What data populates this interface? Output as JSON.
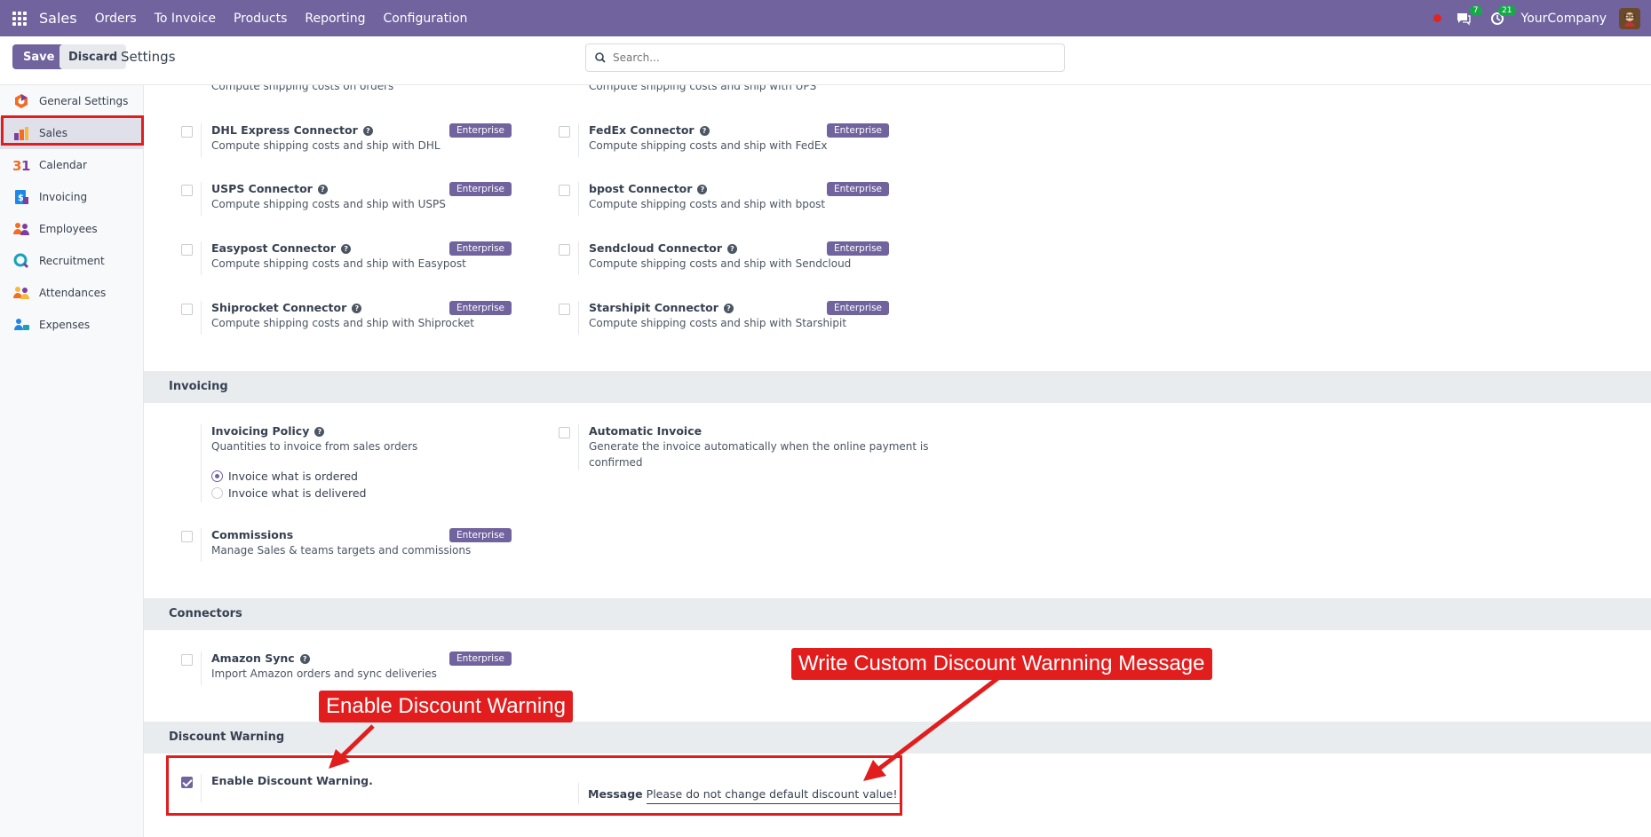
{
  "navbar": {
    "app_name": "Sales",
    "menu": [
      "Orders",
      "To Invoice",
      "Products",
      "Reporting",
      "Configuration"
    ],
    "messages_count": "7",
    "activities_count": "21",
    "company": "YourCompany"
  },
  "control_panel": {
    "save_label": "Save",
    "discard_label": "Discard",
    "title": "Settings",
    "search_placeholder": "Search..."
  },
  "sidebar": {
    "items": [
      {
        "label": "General Settings",
        "icon": "settings-icon"
      },
      {
        "label": "Sales",
        "icon": "sales-icon"
      },
      {
        "label": "Calendar",
        "icon": "calendar-icon"
      },
      {
        "label": "Invoicing",
        "icon": "invoicing-icon"
      },
      {
        "label": "Employees",
        "icon": "employees-icon"
      },
      {
        "label": "Recruitment",
        "icon": "recruitment-icon"
      },
      {
        "label": "Attendances",
        "icon": "attendances-icon"
      },
      {
        "label": "Expenses",
        "icon": "expenses-icon"
      }
    ]
  },
  "shipping": {
    "cut_left": "Compute shipping costs on orders",
    "cut_right": "Compute shipping costs and ship with UPS",
    "connectors": [
      {
        "title": "DHL Express Connector",
        "desc": "Compute shipping costs and ship with DHL",
        "badge": "Enterprise"
      },
      {
        "title": "FedEx Connector",
        "desc": "Compute shipping costs and ship with FedEx",
        "badge": "Enterprise"
      },
      {
        "title": "USPS Connector",
        "desc": "Compute shipping costs and ship with USPS",
        "badge": "Enterprise"
      },
      {
        "title": "bpost Connector",
        "desc": "Compute shipping costs and ship with bpost",
        "badge": "Enterprise"
      },
      {
        "title": "Easypost Connector",
        "desc": "Compute shipping costs and ship with Easypost",
        "badge": "Enterprise"
      },
      {
        "title": "Sendcloud Connector",
        "desc": "Compute shipping costs and ship with Sendcloud",
        "badge": "Enterprise"
      },
      {
        "title": "Shiprocket Connector",
        "desc": "Compute shipping costs and ship with Shiprocket",
        "badge": "Enterprise"
      },
      {
        "title": "Starshipit Connector",
        "desc": "Compute shipping costs and ship with Starshipit",
        "badge": "Enterprise"
      }
    ]
  },
  "invoicing": {
    "header": "Invoicing",
    "policy_title": "Invoicing Policy",
    "policy_desc": "Quantities to invoice from sales orders",
    "option_ordered": "Invoice what is ordered",
    "option_delivered": "Invoice what is delivered",
    "auto_title": "Automatic Invoice",
    "auto_desc_1": "Generate the invoice automatically when the online payment is",
    "auto_desc_2": "confirmed",
    "commissions_title": "Commissions",
    "commissions_desc": "Manage Sales & teams targets and commissions",
    "commissions_badge": "Enterprise"
  },
  "connectors": {
    "header": "Connectors",
    "amazon_title": "Amazon Sync",
    "amazon_desc": "Import Amazon orders and sync deliveries",
    "amazon_badge": "Enterprise"
  },
  "discount_warning": {
    "header": "Discount Warning",
    "enable_label": "Enable Discount Warning.",
    "enabled": true,
    "message_label": "Message",
    "message_value": "Please do not change default discount value!"
  },
  "annotations": {
    "enable_callout": "Enable Discount Warning",
    "message_callout": "Write Custom Discount Warnning Message",
    "color": "#e11d1d"
  },
  "colors": {
    "brand": "#71639e",
    "section_bg": "#e9ecef"
  }
}
